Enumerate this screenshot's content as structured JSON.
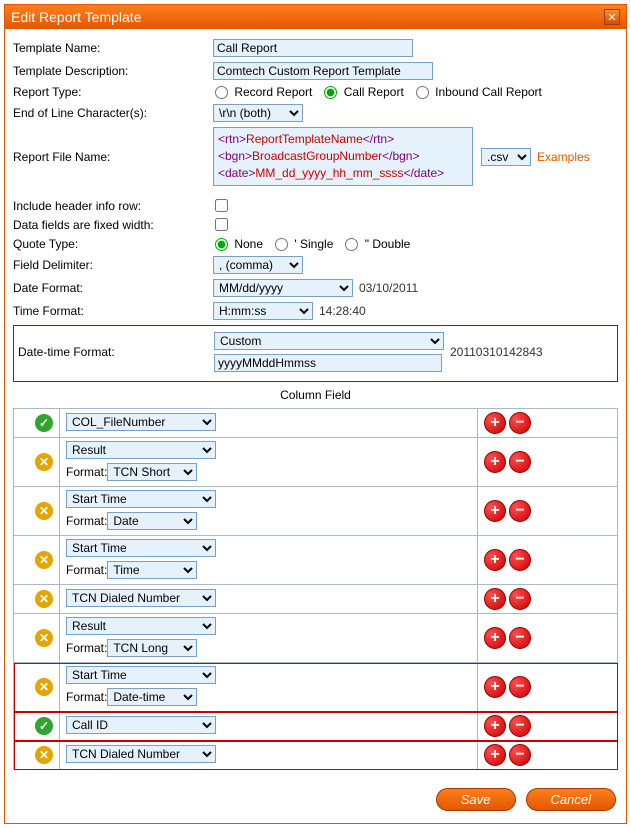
{
  "title": "Edit Report Template",
  "labels": {
    "template_name": "Template Name:",
    "template_desc": "Template Description:",
    "report_type": "Report Type:",
    "eol": "End of Line Character(s):",
    "file_name": "Report File Name:",
    "include_header": "Include header info row:",
    "fixed_width": "Data fields are fixed width:",
    "quote_type": "Quote Type:",
    "field_delim": "Field Delimiter:",
    "date_format": "Date Format:",
    "time_format": "Time Format:",
    "datetime_format": "Date-time Format:",
    "column_field": "Column Field",
    "format": "Format:",
    "examples": "Examples"
  },
  "values": {
    "template_name": "Call Report",
    "template_desc": "Comtech Custom Report Template",
    "eol": "\\r\\n (both)",
    "file_ext": ".csv",
    "quote_none": "None",
    "quote_single": "' Single",
    "quote_double": "\" Double",
    "field_delim": ", (comma)",
    "date_format": "MM/dd/yyyy",
    "date_sample": "03/10/2011",
    "time_format": "H:mm:ss",
    "time_sample": "14:28:40",
    "datetime_sel": "Custom",
    "datetime_custom": "yyyyMMddHmmss",
    "datetime_sample": "20110310142843"
  },
  "report_types": {
    "record": "Record Report",
    "call": "Call Report",
    "inbound": "Inbound Call Report",
    "selected": "call"
  },
  "report_file_markup": {
    "l1_tag_open": "<rtn>",
    "l1_val": "ReportTemplateName",
    "l1_tag_close": "</rtn>",
    "l2_tag_open": "<bgn>",
    "l2_val": "BroadcastGroupNumber",
    "l2_tag_close": "</bgn>",
    "l3_tag_open": "<date>",
    "l3_val": "MM_dd_yyyy_hh_mm_ssss",
    "l3_tag_close": "</date>"
  },
  "columns": [
    {
      "status": "ok",
      "field": "COL_FileNumber",
      "format": null,
      "highlight": false
    },
    {
      "status": "warn",
      "field": "Result",
      "format": "TCN Short",
      "highlight": false
    },
    {
      "status": "warn",
      "field": "Start Time",
      "format": "Date",
      "highlight": false
    },
    {
      "status": "warn",
      "field": "Start Time",
      "format": "Time",
      "highlight": false
    },
    {
      "status": "warn",
      "field": "TCN Dialed Number",
      "format": null,
      "highlight": false
    },
    {
      "status": "warn",
      "field": "Result",
      "format": "TCN Long",
      "highlight": false
    },
    {
      "status": "warn",
      "field": "Start Time",
      "format": "Date-time",
      "highlight": true
    },
    {
      "status": "ok",
      "field": "Call ID",
      "format": null,
      "highlight": true
    },
    {
      "status": "warn",
      "field": "TCN Dialed Number",
      "format": null,
      "highlight": true
    }
  ],
  "buttons": {
    "save": "Save",
    "cancel": "Cancel"
  }
}
